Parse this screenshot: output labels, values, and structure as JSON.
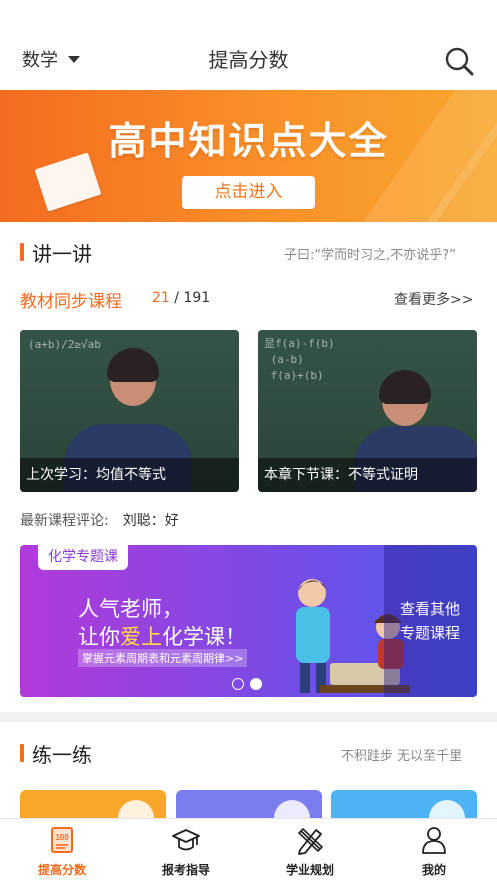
{
  "header": {
    "subject": "数学",
    "title": "提高分数"
  },
  "banner": {
    "title": "高中知识点大全",
    "button": "点击进入"
  },
  "lecture_section": {
    "title": "讲一讲",
    "quote": "子曰:“学而时习之,不亦说乎?”",
    "sync_label": "教材同步课程",
    "sync_current": "21",
    "sync_total": " / 191",
    "more": "查看更多>>",
    "videos": [
      {
        "caption": "上次学习：均值不等式"
      },
      {
        "caption": "本章下节课：不等式证明"
      }
    ],
    "review_label": "最新课程评论:",
    "review_text": "刘聪：好"
  },
  "chem_banner": {
    "tag": "化学专题课",
    "line1": "人气老师，",
    "line2_pre": "让你",
    "line2_hi": "爱上",
    "line2_post": "化学课！",
    "sub": "掌握元素周期表和元素周期律>>",
    "side": "查看其他专题课程",
    "slide_count": 2,
    "active_slide": 2
  },
  "practice_section": {
    "title": "练一练",
    "quote": "不积跬步 无以至千里",
    "cards": [
      {
        "color": "#f9a62c"
      },
      {
        "color": "#7a7cf0"
      },
      {
        "color": "#4cb4f2"
      }
    ]
  },
  "tabbar": {
    "items": [
      {
        "label": "提高分数",
        "icon": "score-book-icon",
        "active": true
      },
      {
        "label": "报考指导",
        "icon": "graduation-cap-icon",
        "active": false
      },
      {
        "label": "学业规划",
        "icon": "pencil-ruler-icon",
        "active": false
      },
      {
        "label": "我的",
        "icon": "person-icon",
        "active": false
      }
    ]
  },
  "colors": {
    "accent": "#f46b1f",
    "chem_start": "#b23ad9",
    "chem_end": "#4e5bf0"
  }
}
